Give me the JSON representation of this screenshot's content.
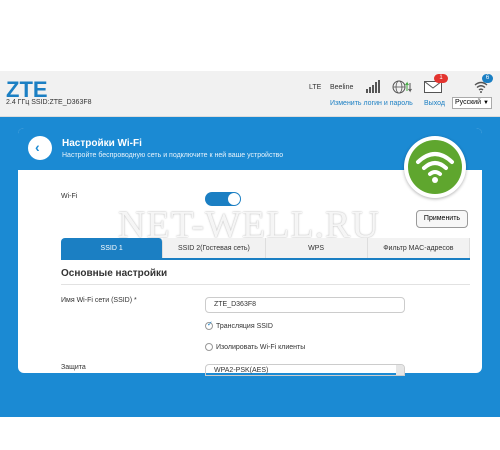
{
  "header": {
    "brand": "ZTE",
    "ssid_line": "2.4 ГГц SSID:ZTE_D363F8",
    "network_type": "LTE",
    "operator": "Beeline",
    "mail_count": "1",
    "wifi_count": "6",
    "change_login_link": "Изменить логин и пароль",
    "logout_link": "Выход",
    "language": "Русский"
  },
  "page": {
    "title": "Настройки Wi-Fi",
    "subtitle": "Настройте беспроводную сеть и подключите к ней ваше устройство",
    "back_icon": "chevron-left-icon"
  },
  "wifi_toggle": {
    "label": "Wi-Fi",
    "state": "on"
  },
  "apply_button": "Применить",
  "watermark": "NET-WELL.RU",
  "tabs": [
    {
      "label": "SSID 1",
      "active": true
    },
    {
      "label": "SSID 2(Гостевая сеть)",
      "active": false
    },
    {
      "label": "WPS",
      "active": false
    },
    {
      "label": "Фильтр MAC-адресов",
      "active": false
    }
  ],
  "section": {
    "title": "Основные настройки",
    "ssid_label": "Имя Wi-Fi сети (SSID) *",
    "ssid_value": "ZTE_D363F8",
    "broadcast_label": "Трансляция SSID",
    "broadcast_checked": true,
    "isolate_label": "Изолировать Wi-Fi клиенты",
    "isolate_checked": false,
    "security_label": "Защита",
    "security_value": "WPA2-PSK(AES)"
  },
  "colors": {
    "brand_blue": "#1b8ad3",
    "accent_green": "#5fa62e",
    "badge_red": "#e3342f"
  }
}
